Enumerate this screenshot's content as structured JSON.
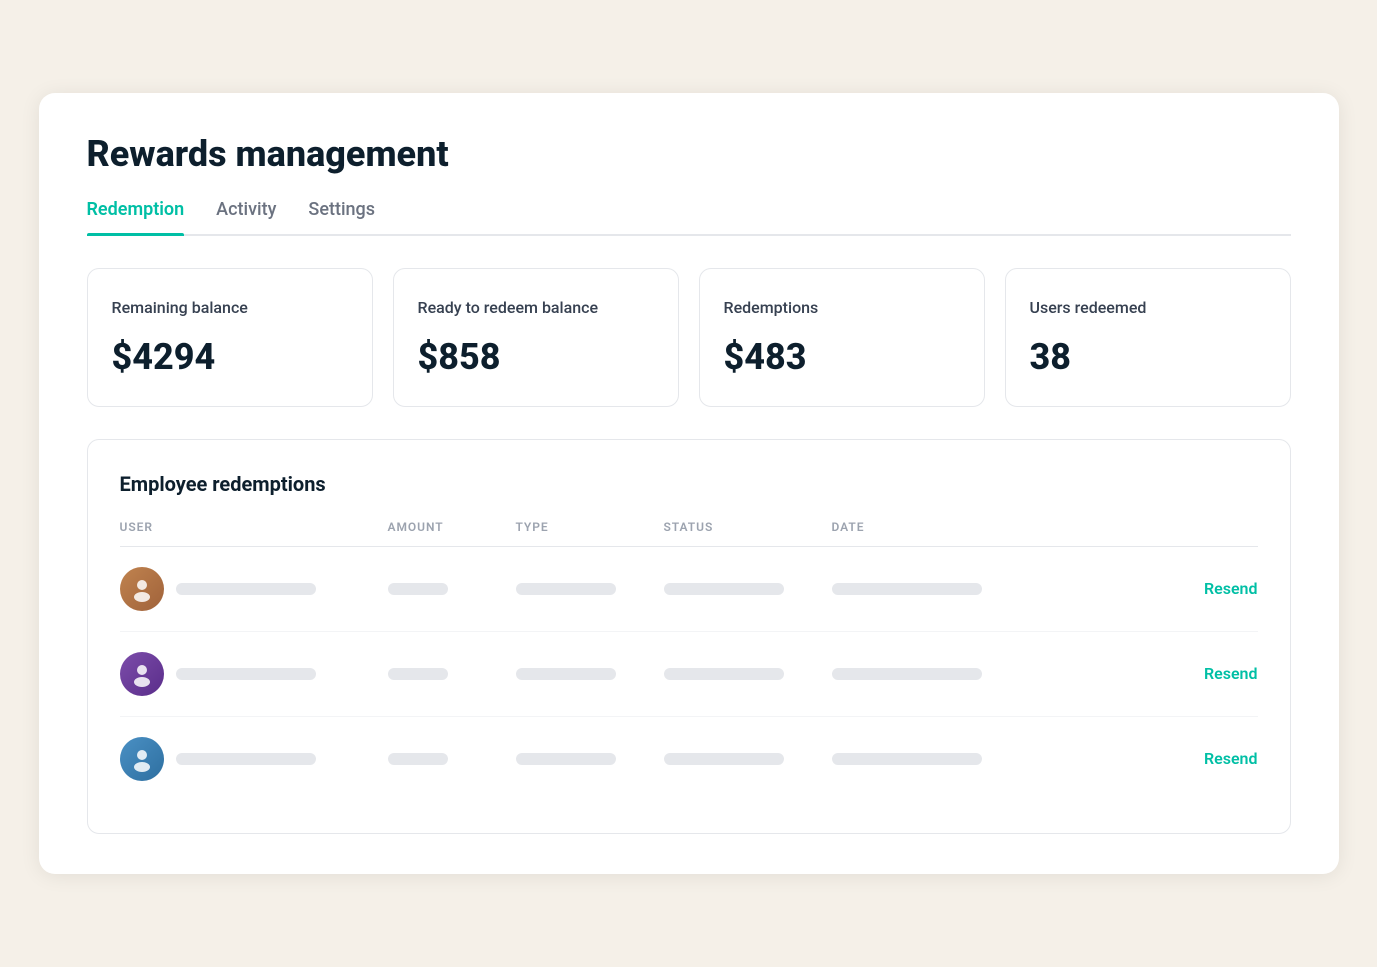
{
  "page": {
    "title": "Rewards management"
  },
  "tabs": [
    {
      "id": "redemption",
      "label": "Redemption",
      "active": true
    },
    {
      "id": "activity",
      "label": "Activity",
      "active": false
    },
    {
      "id": "settings",
      "label": "Settings",
      "active": false
    }
  ],
  "stats": [
    {
      "id": "remaining-balance",
      "label": "Remaining balance",
      "value": "$4294"
    },
    {
      "id": "ready-to-redeem",
      "label": "Ready to redeem balance",
      "value": "$858"
    },
    {
      "id": "redemptions",
      "label": "Redemptions",
      "value": "$483"
    },
    {
      "id": "users-redeemed",
      "label": "Users redeemed",
      "value": "38"
    }
  ],
  "table": {
    "title": "Employee redemptions",
    "columns": [
      {
        "id": "user",
        "label": "USER"
      },
      {
        "id": "amount",
        "label": "AMOUNT"
      },
      {
        "id": "type",
        "label": "TYPE"
      },
      {
        "id": "status",
        "label": "STATUS"
      },
      {
        "id": "date",
        "label": "DATE"
      },
      {
        "id": "action",
        "label": ""
      }
    ],
    "rows": [
      {
        "id": 1,
        "avatar": "person1",
        "resend": "Resend"
      },
      {
        "id": 2,
        "avatar": "person2",
        "resend": "Resend"
      },
      {
        "id": 3,
        "avatar": "person3",
        "resend": "Resend"
      }
    ]
  },
  "actions": {
    "resend_label": "Resend"
  },
  "colors": {
    "accent": "#00bfa5",
    "title_color": "#0d1f2d"
  }
}
